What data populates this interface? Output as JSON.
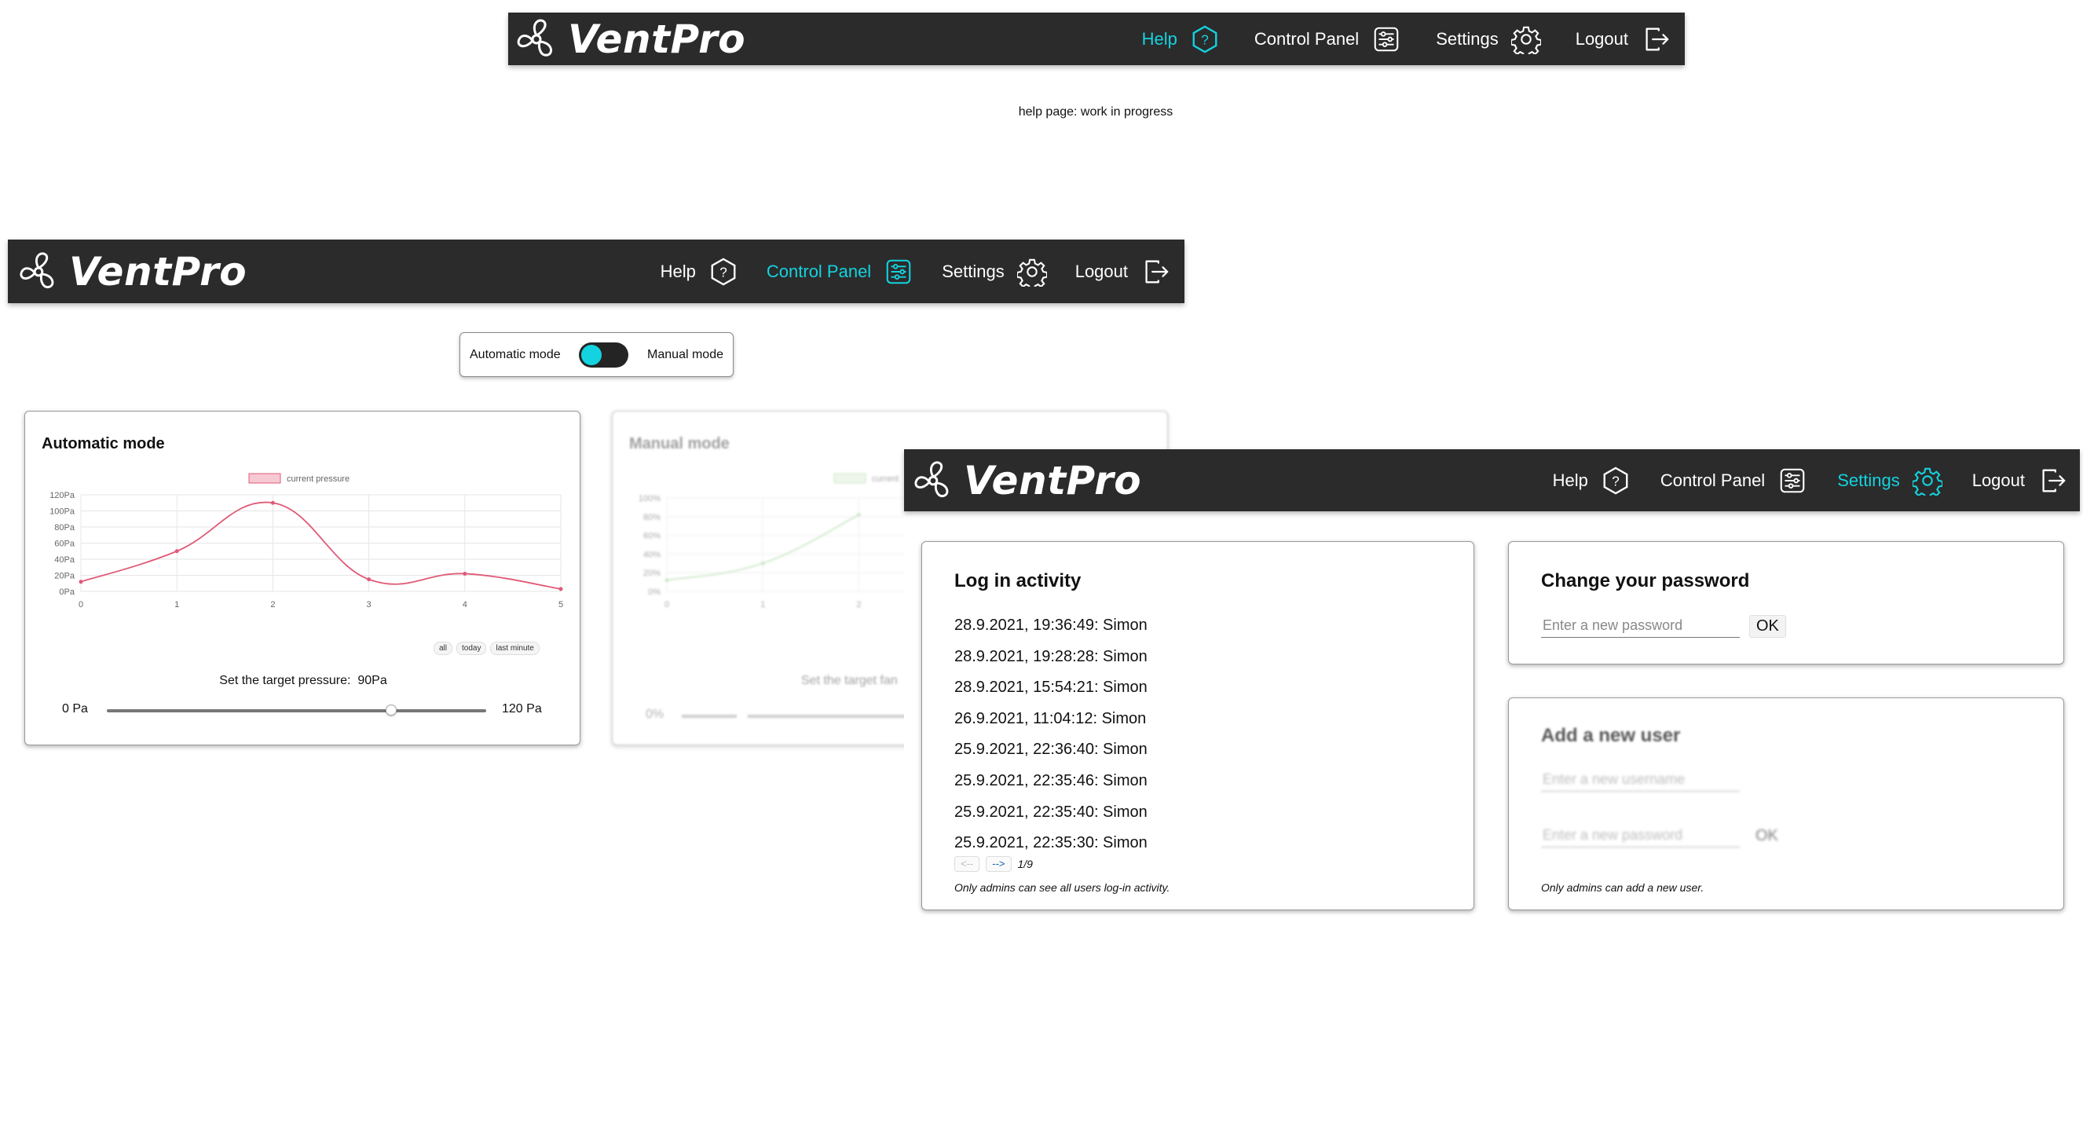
{
  "app": {
    "name": "VentPro"
  },
  "colors": {
    "navbar": "#2b2b2b",
    "accent": "#14d3e0",
    "chart_line": "#e05a78",
    "chart_fill": "#f7c9d3",
    "manual_line": "#a8d8a0"
  },
  "nav": {
    "help": "Help",
    "control_panel": "Control Panel",
    "settings": "Settings",
    "logout": "Logout",
    "icons": [
      "help-hexagon-icon",
      "sliders-panel-icon",
      "gear-icon",
      "logout-arrow-icon"
    ]
  },
  "help_page": {
    "message": "help page: work in progress"
  },
  "control_panel": {
    "mode_toggle": {
      "left_label": "Automatic mode",
      "right_label": "Manual mode",
      "state": "automatic"
    },
    "automatic": {
      "title": "Automatic mode",
      "range_buttons": [
        "all",
        "today",
        "last minute"
      ],
      "target_label": "Set the target pressure:",
      "target_value": "90Pa",
      "slider_min": "0 Pa",
      "slider_max": "120 Pa",
      "slider_fraction": 0.75
    },
    "manual": {
      "title": "Manual mode",
      "target_label": "Set the target fan",
      "slider_min": "0%",
      "legend_partial": "current"
    }
  },
  "chart_data": [
    {
      "type": "line",
      "title": "",
      "legend": [
        "current pressure"
      ],
      "x": [
        0,
        1,
        2,
        3,
        4,
        5
      ],
      "xticks": [
        "0",
        "1",
        "2",
        "3",
        "4",
        "5"
      ],
      "yticks": [
        "0Pa",
        "20Pa",
        "40Pa",
        "60Pa",
        "80Pa",
        "100Pa",
        "120Pa"
      ],
      "ylim": [
        0,
        120
      ],
      "series": [
        {
          "name": "current pressure",
          "values": [
            12,
            50,
            110,
            15,
            22,
            3
          ]
        }
      ],
      "grid": true,
      "legend_position": "top"
    },
    {
      "type": "line",
      "title": "",
      "xticks": [
        "0",
        "1",
        "2"
      ],
      "yticks": [
        "0%",
        "20%",
        "40%",
        "60%",
        "80%",
        "100%"
      ],
      "ylim": [
        0,
        100
      ],
      "series": [
        {
          "values": [
            12,
            30,
            82
          ]
        }
      ],
      "grid": true
    }
  ],
  "settings": {
    "log": {
      "title": "Log in activity",
      "entries": [
        "28.9.2021, 19:36:49: Simon",
        "28.9.2021, 19:28:28: Simon",
        "28.9.2021, 15:54:21: Simon",
        "26.9.2021, 11:04:12: Simon",
        "25.9.2021, 22:36:40: Simon",
        "25.9.2021, 22:35:46: Simon",
        "25.9.2021, 22:35:40: Simon",
        "25.9.2021, 22:35:30: Simon"
      ],
      "prev": "<--",
      "next": "-->",
      "page": "1/9",
      "note": "Only admins can see all users log-in activity."
    },
    "password": {
      "title": "Change your password",
      "placeholder": "Enter a new password",
      "ok": "OK"
    },
    "new_user": {
      "title": "Add a new user",
      "username_placeholder": "Enter a new username",
      "password_placeholder": "Enter a new password",
      "ok": "OK",
      "note": "Only admins can add a new user."
    }
  }
}
